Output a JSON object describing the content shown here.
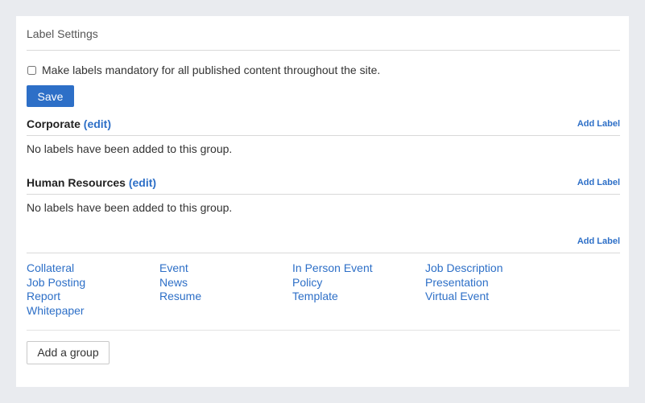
{
  "header": {
    "title": "Label Settings"
  },
  "mandatory": {
    "label": "Make labels mandatory for all published content throughout the site.",
    "checked": false
  },
  "save_label": "Save",
  "groups": [
    {
      "title": "Corporate",
      "edit": "(edit)",
      "add_label": "Add Label",
      "empty": "No labels have been added to this group."
    },
    {
      "title": "Human Resources",
      "edit": "(edit)",
      "add_label": "Add Label",
      "empty": "No labels have been added to this group."
    }
  ],
  "ungrouped": {
    "add_label": "Add Label",
    "labels": [
      "Collateral",
      "Event",
      "In Person Event",
      "Job Description",
      "Job Posting",
      "News",
      "Policy",
      "Presentation",
      "Report",
      "Resume",
      "Template",
      "Virtual Event",
      "Whitepaper"
    ]
  },
  "add_group_label": "Add a group"
}
